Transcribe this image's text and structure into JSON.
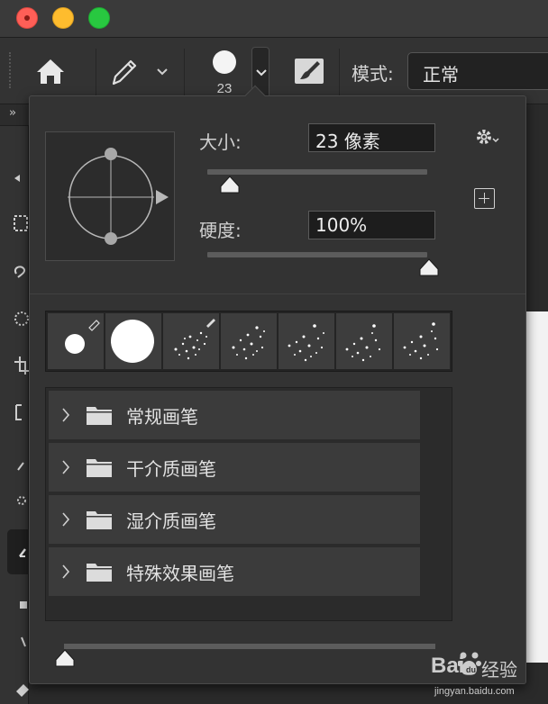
{
  "toolbar": {
    "brush_size": "23",
    "mode_label": "模式:",
    "mode_value": "正常"
  },
  "leftbar": {
    "collapse_label": "»"
  },
  "brush_panel": {
    "size_label": "大小:",
    "size_value": "23 像素",
    "size_slider": 0.04,
    "hardness_label": "硬度:",
    "hardness_value": "100%",
    "hardness_slider": 1.0,
    "recent_brushes": [
      "hard-round-small",
      "hard-round-large",
      "spatter-1",
      "spatter-2",
      "spatter-3",
      "spatter-4",
      "spatter-5"
    ],
    "preset_groups": [
      {
        "label": "常规画笔"
      },
      {
        "label": "干介质画笔"
      },
      {
        "label": "湿介质画笔"
      },
      {
        "label": "特殊效果画笔"
      }
    ],
    "preview_size_slider": 0.0
  },
  "watermark": {
    "brand": "Bai",
    "brand_cn": "经验",
    "url": "jingyan.baidu.com"
  },
  "colors": {
    "panel_bg": "#333333",
    "input_bg": "#1d1d1d",
    "row_bg": "#3b3b3b",
    "canvas": "#f2f2f2"
  }
}
